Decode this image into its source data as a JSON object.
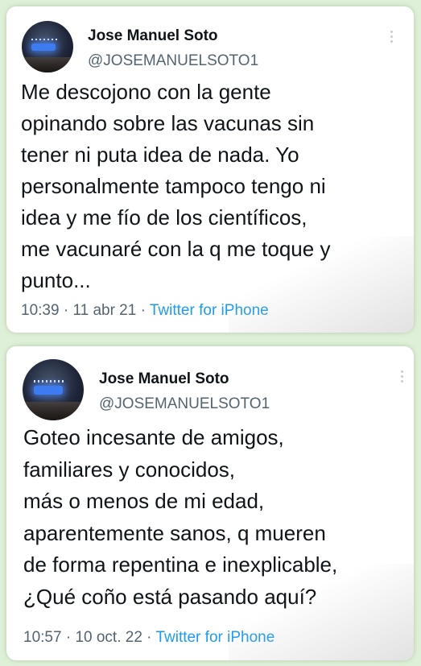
{
  "tweets": [
    {
      "author_name": "Jose Manuel Soto",
      "handle": "@JOSEMANUELSOTO1",
      "text": "Me descojono con la gente\nopinando sobre las vacunas sin\ntener ni puta idea de nada. Yo\npersonalmente tampoco tengo ni\nidea y me fío de los científicos,\nme vacunaré con la q me toque y\npunto...",
      "time": "10:39",
      "date": "11 abr 21",
      "separator": "·",
      "source": "Twitter for iPhone"
    },
    {
      "author_name": "Jose Manuel Soto",
      "handle": "@JOSEMANUELSOTO1",
      "text": "Goteo incesante de amigos,\nfamiliares y conocidos,\nmás o menos de mi edad,\naparentemente sanos, q mueren\nde forma repentina e inexplicable,\n¿Qué coño está pasando aquí?",
      "time": "10:57",
      "date": "10 oct. 22",
      "separator": "·",
      "source": "Twitter for iPhone"
    }
  ],
  "colors": {
    "background": "#dff0d8",
    "card": "#ffffff",
    "text": "#0f1419",
    "muted": "#536471",
    "link": "#1d9bf0"
  },
  "icons": {
    "more": "more-vertical-icon",
    "avatar": "profile-avatar"
  }
}
